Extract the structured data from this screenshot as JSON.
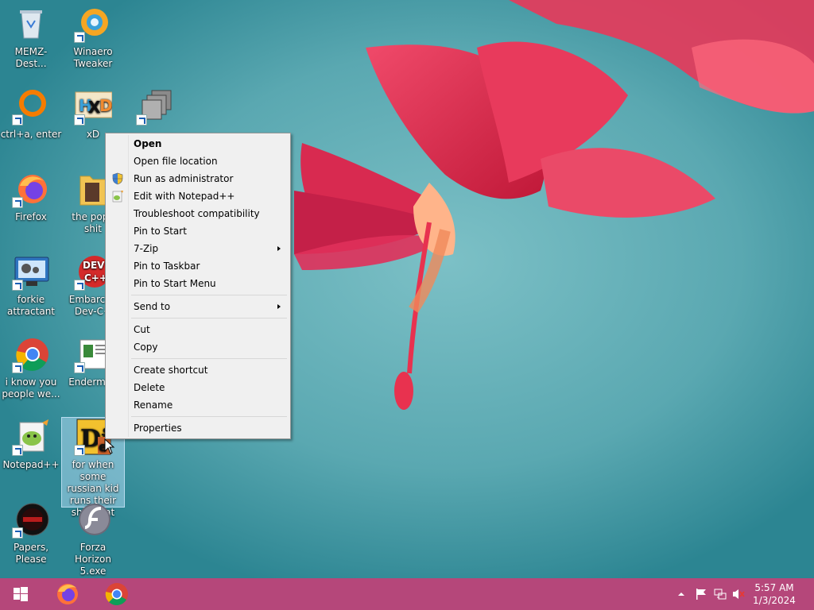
{
  "desktop": {
    "icons": [
      {
        "label": "MEMZ-Dest...",
        "icon": "recycle-bin-icon"
      },
      {
        "label": "Winaero Tweaker",
        "icon": "winaero-icon"
      },
      {
        "label": "ctrl+a, enter",
        "icon": "orange-ring-icon"
      },
      {
        "label": "xD",
        "icon": "hxd-icon"
      },
      {
        "label": "",
        "icon": "stacked-windows-icon"
      },
      {
        "label": "Firefox",
        "icon": "firefox-icon"
      },
      {
        "label": "the popo shit",
        "icon": "folder-icon"
      },
      {
        "label": "forkie attractant",
        "icon": "settings-monitor-icon"
      },
      {
        "label": "Embarcad Dev-C+",
        "icon": "devcpp-icon"
      },
      {
        "label": "i know you people we...",
        "icon": "chrome-icon"
      },
      {
        "label": "Enderman",
        "icon": "document-icon"
      },
      {
        "label": "Notepad++",
        "icon": "notepadpp-icon"
      },
      {
        "label": "for when some russian kid runs their shitty rat",
        "icon": "die-icon"
      },
      {
        "label": "Papers, Please",
        "icon": "papers-please-icon"
      },
      {
        "label": "Forza Horizon 5.exe",
        "icon": "flash-icon"
      }
    ]
  },
  "context_menu": {
    "items": [
      {
        "label": "Open",
        "bold": true
      },
      {
        "label": "Open file location"
      },
      {
        "label": "Run as administrator",
        "icon": "shield-icon"
      },
      {
        "label": "Edit with Notepad++",
        "icon": "notepadpp-icon"
      },
      {
        "label": "Troubleshoot compatibility"
      },
      {
        "label": "Pin to Start"
      },
      {
        "label": "7-Zip",
        "submenu": true
      },
      {
        "label": "Pin to Taskbar"
      },
      {
        "label": "Pin to Start Menu"
      },
      {
        "separator": true
      },
      {
        "label": "Send to",
        "submenu": true
      },
      {
        "separator": true
      },
      {
        "label": "Cut"
      },
      {
        "label": "Copy"
      },
      {
        "separator": true
      },
      {
        "label": "Create shortcut"
      },
      {
        "label": "Delete"
      },
      {
        "label": "Rename"
      },
      {
        "separator": true
      },
      {
        "label": "Properties"
      }
    ]
  },
  "taskbar": {
    "color": "#b5477a",
    "pinned": [
      {
        "icon": "windows-start-icon"
      },
      {
        "icon": "firefox-icon"
      },
      {
        "icon": "chrome-icon"
      }
    ],
    "tray": {
      "icons": [
        "chevron-up-icon",
        "flag-icon",
        "network-icon",
        "volume-muted-icon"
      ],
      "time": "5:57 AM",
      "date": "1/3/2024"
    }
  }
}
